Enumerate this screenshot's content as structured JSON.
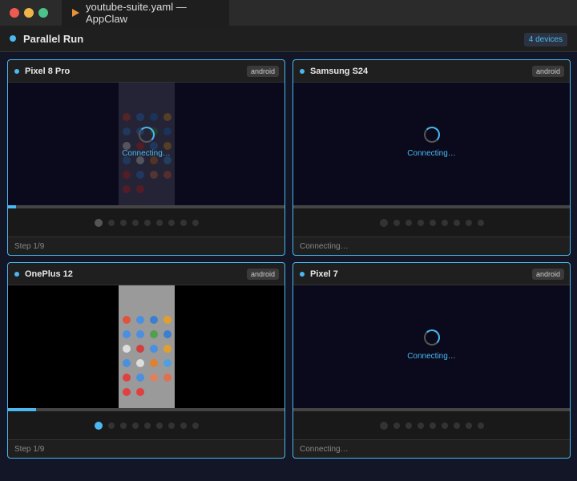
{
  "window": {
    "title": "youtube-suite.yaml — AppClaw",
    "traffic_colors": [
      "#ee5a4f",
      "#f0b34a",
      "#4cc38a"
    ]
  },
  "header": {
    "title": "Parallel Run",
    "device_count": "4 devices"
  },
  "devices": [
    {
      "name": "Pixel 8 Pro",
      "platform": "android",
      "overlay": "Connecting…",
      "status": "Step 1/9",
      "progress": 0.03,
      "current_step": 1,
      "total_steps": 9,
      "screen": "dim"
    },
    {
      "name": "Samsung S24",
      "platform": "android",
      "overlay": "Connecting…",
      "status": "Connecting…",
      "progress": 0,
      "current_step": 0,
      "total_steps": 9,
      "screen": "none"
    },
    {
      "name": "OnePlus 12",
      "platform": "android",
      "overlay": "",
      "status": "Step 1/9",
      "progress": 0.1,
      "current_step": 1,
      "total_steps": 9,
      "screen": "bright"
    },
    {
      "name": "Pixel 7",
      "platform": "android",
      "overlay": "Connecting…",
      "status": "Connecting…",
      "progress": 0,
      "current_step": 0,
      "total_steps": 9,
      "screen": "none"
    }
  ]
}
